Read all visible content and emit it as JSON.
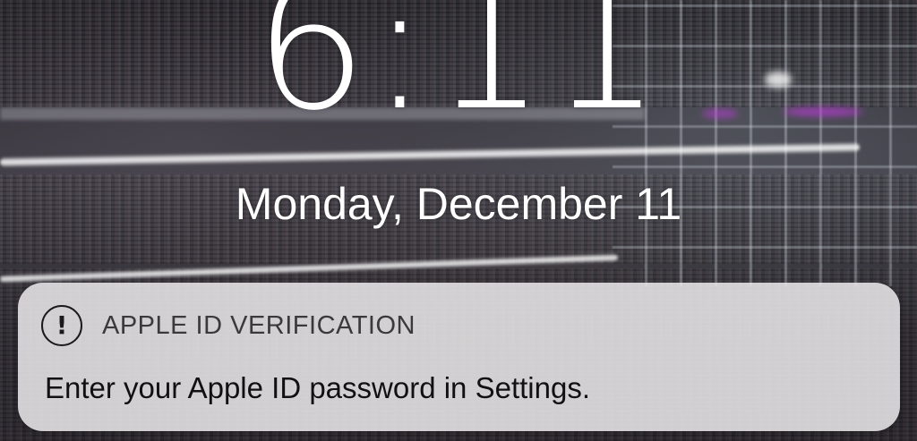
{
  "lock_screen": {
    "time": "6:11",
    "date": "Monday, December 11"
  },
  "notification": {
    "icon": "exclamation-circle-icon",
    "app_name": "APPLE ID VERIFICATION",
    "message": "Enter your Apple ID password in Settings."
  },
  "colors": {
    "banner_background": "#E8E6E8",
    "clock_text": "#FFFFFF",
    "app_name_text": "#3A3A3C",
    "message_text": "#111111"
  }
}
